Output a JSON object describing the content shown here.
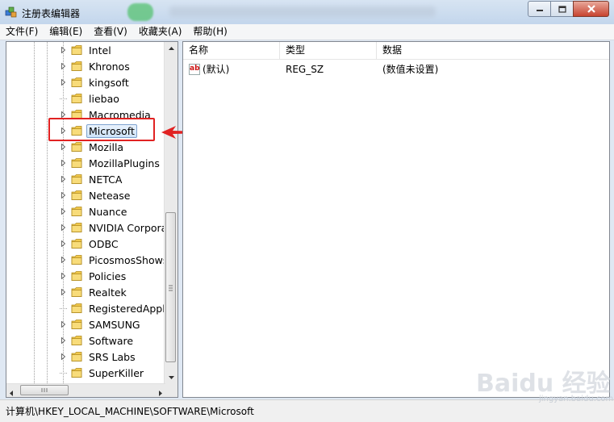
{
  "window": {
    "title": "注册表编辑器",
    "buttons": [
      "minimize",
      "maximize",
      "close"
    ]
  },
  "menu": [
    "文件(F)",
    "编辑(E)",
    "查看(V)",
    "收藏夹(A)",
    "帮助(H)"
  ],
  "tree": {
    "items": [
      {
        "label": "Intel",
        "expandable": true,
        "selected": false
      },
      {
        "label": "Khronos",
        "expandable": true,
        "selected": false
      },
      {
        "label": "kingsoft",
        "expandable": true,
        "selected": false
      },
      {
        "label": "liebao",
        "expandable": false,
        "selected": false
      },
      {
        "label": "Macromedia",
        "expandable": true,
        "selected": false
      },
      {
        "label": "Microsoft",
        "expandable": true,
        "selected": true
      },
      {
        "label": "Mozilla",
        "expandable": true,
        "selected": false
      },
      {
        "label": "MozillaPlugins",
        "expandable": true,
        "selected": false
      },
      {
        "label": "NETCA",
        "expandable": true,
        "selected": false
      },
      {
        "label": "Netease",
        "expandable": true,
        "selected": false
      },
      {
        "label": "Nuance",
        "expandable": true,
        "selected": false
      },
      {
        "label": "NVIDIA Corpora",
        "expandable": true,
        "selected": false
      },
      {
        "label": "ODBC",
        "expandable": true,
        "selected": false
      },
      {
        "label": "PicosmosShows",
        "expandable": true,
        "selected": false
      },
      {
        "label": "Policies",
        "expandable": true,
        "selected": false
      },
      {
        "label": "Realtek",
        "expandable": true,
        "selected": false
      },
      {
        "label": "RegisteredApplic",
        "expandable": false,
        "selected": false
      },
      {
        "label": "SAMSUNG",
        "expandable": true,
        "selected": false
      },
      {
        "label": "Software",
        "expandable": true,
        "selected": false
      },
      {
        "label": "SRS Labs",
        "expandable": true,
        "selected": false
      },
      {
        "label": "SuperKiller",
        "expandable": false,
        "selected": false
      }
    ]
  },
  "list": {
    "columns": [
      "名称",
      "类型",
      "数据"
    ],
    "rows": [
      {
        "icon": "string-value-icon",
        "name": "(默认)",
        "type": "REG_SZ",
        "data": "(数值未设置)"
      }
    ]
  },
  "status": {
    "path": "计算机\\HKEY_LOCAL_MACHINE\\SOFTWARE\\Microsoft"
  },
  "watermark": {
    "text": "Baidu 经验",
    "sub": "jingyan.baidu.com"
  },
  "colors": {
    "annotation": "#e12222",
    "folder": "#f2c94c"
  }
}
